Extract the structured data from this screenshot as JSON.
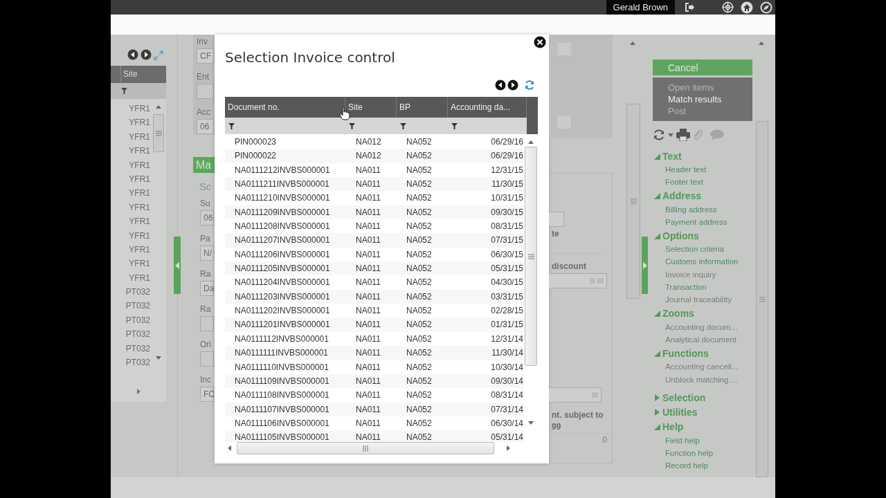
{
  "top_bar": {
    "user": "Gerald Brown"
  },
  "left_grid": {
    "column": "Site",
    "rows": [
      "YFR1",
      "YFR1",
      "YFR1",
      "YFR1",
      "YFR1",
      "YFR1",
      "YFR1",
      "YFR1",
      "YFR1",
      "YFR1",
      "YFR1",
      "YFR1",
      "YFR1",
      "PT032",
      "PT032",
      "PT032",
      "PT032",
      "PT032",
      "PT032"
    ]
  },
  "form_left": {
    "top_fields": [
      {
        "label": "Inv",
        "value": "CF"
      },
      {
        "label": "Ent"
      },
      {
        "label": "Acc",
        "value": "06"
      }
    ],
    "section_title": "Ma",
    "subsection_title": "Sc",
    "fields": [
      {
        "label": "Su",
        "value": "06"
      },
      {
        "label": "Pa",
        "value": "N/"
      },
      {
        "label": "Ra",
        "value": "Da"
      },
      {
        "label": "Ra"
      },
      {
        "label": "Ori"
      },
      {
        "label": "Inc",
        "value": "FC"
      }
    ]
  },
  "form_right": {
    "labels": [
      "te",
      "discount"
    ],
    "note": "nt. subject to",
    "note_value": "99",
    "total": "0"
  },
  "side_panel": {
    "button": "Cancel",
    "actions": [
      {
        "label": "Open items",
        "disabled": true
      },
      {
        "label": "Match results",
        "disabled": false
      },
      {
        "label": "Post",
        "disabled": true
      }
    ],
    "sections": [
      {
        "title": "Text",
        "expanded": true,
        "items": [
          {
            "label": "Header text",
            "disabled": false
          },
          {
            "label": "Footer text",
            "disabled": false
          }
        ]
      },
      {
        "title": "Address",
        "expanded": true,
        "items": [
          {
            "label": "Billing address",
            "disabled": false
          },
          {
            "label": "Payment address",
            "disabled": false
          }
        ]
      },
      {
        "title": "Options",
        "expanded": true,
        "items": [
          {
            "label": "Selection criteria",
            "disabled": false
          },
          {
            "label": "Customs information",
            "disabled": false
          },
          {
            "label": "Invoice inquiry",
            "disabled": true
          },
          {
            "label": "Transaction",
            "disabled": false
          },
          {
            "label": "Journal traceability",
            "disabled": true
          }
        ]
      },
      {
        "title": "Zooms",
        "expanded": true,
        "items": [
          {
            "label": "Accounting docum...",
            "disabled": true
          },
          {
            "label": "Analytical document",
            "disabled": true
          }
        ]
      },
      {
        "title": "Functions",
        "expanded": true,
        "items": [
          {
            "label": "Accounting cancell...",
            "disabled": true
          },
          {
            "label": "Unblock matching ...",
            "disabled": true
          }
        ]
      },
      {
        "title": "Selection",
        "expanded": false
      },
      {
        "title": "Utilities",
        "expanded": false
      },
      {
        "title": "Help",
        "expanded": true,
        "items": [
          {
            "label": "Field help",
            "disabled": false
          },
          {
            "label": "Function help",
            "disabled": false
          },
          {
            "label": "Record help",
            "disabled": false
          }
        ]
      }
    ]
  },
  "dialog": {
    "title": "Selection Invoice control",
    "columns": [
      "Document no.",
      "Site",
      "BP",
      "Accounting da..."
    ],
    "rows": [
      [
        "PIN000023",
        "NA012",
        "NA052",
        "06/29/16"
      ],
      [
        "PIN000022",
        "NA012",
        "NA052",
        "06/29/16"
      ],
      [
        "NA0111212INVBS000001",
        "NA011",
        "NA052",
        "12/31/15"
      ],
      [
        "NA0111211INVBS000001",
        "NA011",
        "NA052",
        "11/30/15"
      ],
      [
        "NA0111210INVBS000001",
        "NA011",
        "NA052",
        "10/31/15"
      ],
      [
        "NA0111209INVBS000001",
        "NA011",
        "NA052",
        "09/30/15"
      ],
      [
        "NA0111208INVBS000001",
        "NA011",
        "NA052",
        "08/31/15"
      ],
      [
        "NA0111207INVBS000001",
        "NA011",
        "NA052",
        "07/31/15"
      ],
      [
        "NA0111206INVBS000001",
        "NA011",
        "NA052",
        "06/30/15"
      ],
      [
        "NA0111205INVBS000001",
        "NA011",
        "NA052",
        "05/31/15"
      ],
      [
        "NA0111204INVBS000001",
        "NA011",
        "NA052",
        "04/30/15"
      ],
      [
        "NA0111203INVBS000001",
        "NA011",
        "NA052",
        "03/31/15"
      ],
      [
        "NA0111202INVBS000001",
        "NA011",
        "NA052",
        "02/28/15"
      ],
      [
        "NA0111201INVBS000001",
        "NA011",
        "NA052",
        "01/31/15"
      ],
      [
        "NA0111112INVBS000001",
        "NA011",
        "NA052",
        "12/31/14"
      ],
      [
        "NA0111111INVBS000001",
        "NA011",
        "NA052",
        "11/30/14"
      ],
      [
        "NA0111110INVBS000001",
        "NA011",
        "NA052",
        "10/30/14"
      ],
      [
        "NA0111109INVBS000001",
        "NA011",
        "NA052",
        "09/30/14"
      ],
      [
        "NA0111108INVBS000001",
        "NA011",
        "NA052",
        "08/31/14"
      ],
      [
        "NA0111107INVBS000001",
        "NA011",
        "NA052",
        "07/31/14"
      ],
      [
        "NA0111106INVBS000001",
        "NA011",
        "NA052",
        "06/30/14"
      ],
      [
        "NA0111105INVBS000001",
        "NA011",
        "NA052",
        "05/31/14"
      ]
    ]
  }
}
